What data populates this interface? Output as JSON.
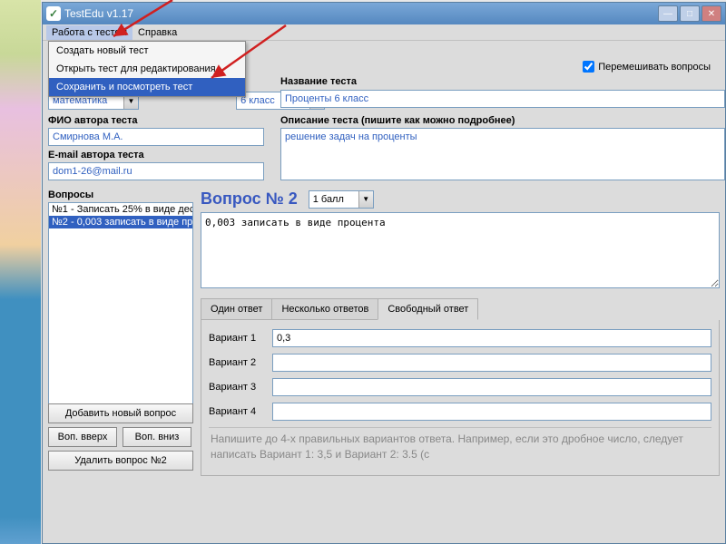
{
  "titlebar": {
    "title": "TestEdu v1.17"
  },
  "menubar": {
    "file": "Работа с тестом",
    "help": "Справка"
  },
  "dropdown": {
    "items": [
      "Создать новый тест",
      "Открыть тест для редактирования",
      "Сохранить и посмотреть тест"
    ]
  },
  "fields": {
    "subject_value": "математика",
    "grade_value": "6 класс",
    "name_label": "Название теста",
    "name_value": "Проценты 6 класс",
    "shuffle_label": "Перемешивать вопросы",
    "author_label": "ФИО автора теста",
    "author_value": "Смирнова М.А.",
    "email_label": "E-mail автора теста",
    "email_value": "dom1-26@mail.ru",
    "desc_label": "Описание теста (пишите как можно подробнее)",
    "desc_value": "решение задач на проценты"
  },
  "questions": {
    "label": "Вопросы",
    "list": [
      "№1 - Записать 25% в виде дес",
      "№2 - 0,003 записать в виде пр"
    ],
    "header": "Вопрос № 2",
    "points": "1 балл",
    "text": "0,003 записать в виде процента"
  },
  "tabs": {
    "t1": "Один ответ",
    "t2": "Несколько ответов",
    "t3": "Свободный ответ"
  },
  "variants": {
    "v1_label": "Вариант 1",
    "v1_value": "0,3",
    "v2_label": "Вариант 2",
    "v2_value": "",
    "v3_label": "Вариант 3",
    "v3_value": "",
    "v4_label": "Вариант 4",
    "v4_value": ""
  },
  "hint": "Напишите до 4-х правильных вариантов ответа. Например, если это\nдробное число, следует написать Вариант 1: 3,5 и Вариант 2: 3.5 (с",
  "buttons": {
    "add": "Добавить новый вопрос",
    "up": "Воп. вверх",
    "down": "Воп. вниз",
    "del": "Удалить вопрос №2"
  }
}
